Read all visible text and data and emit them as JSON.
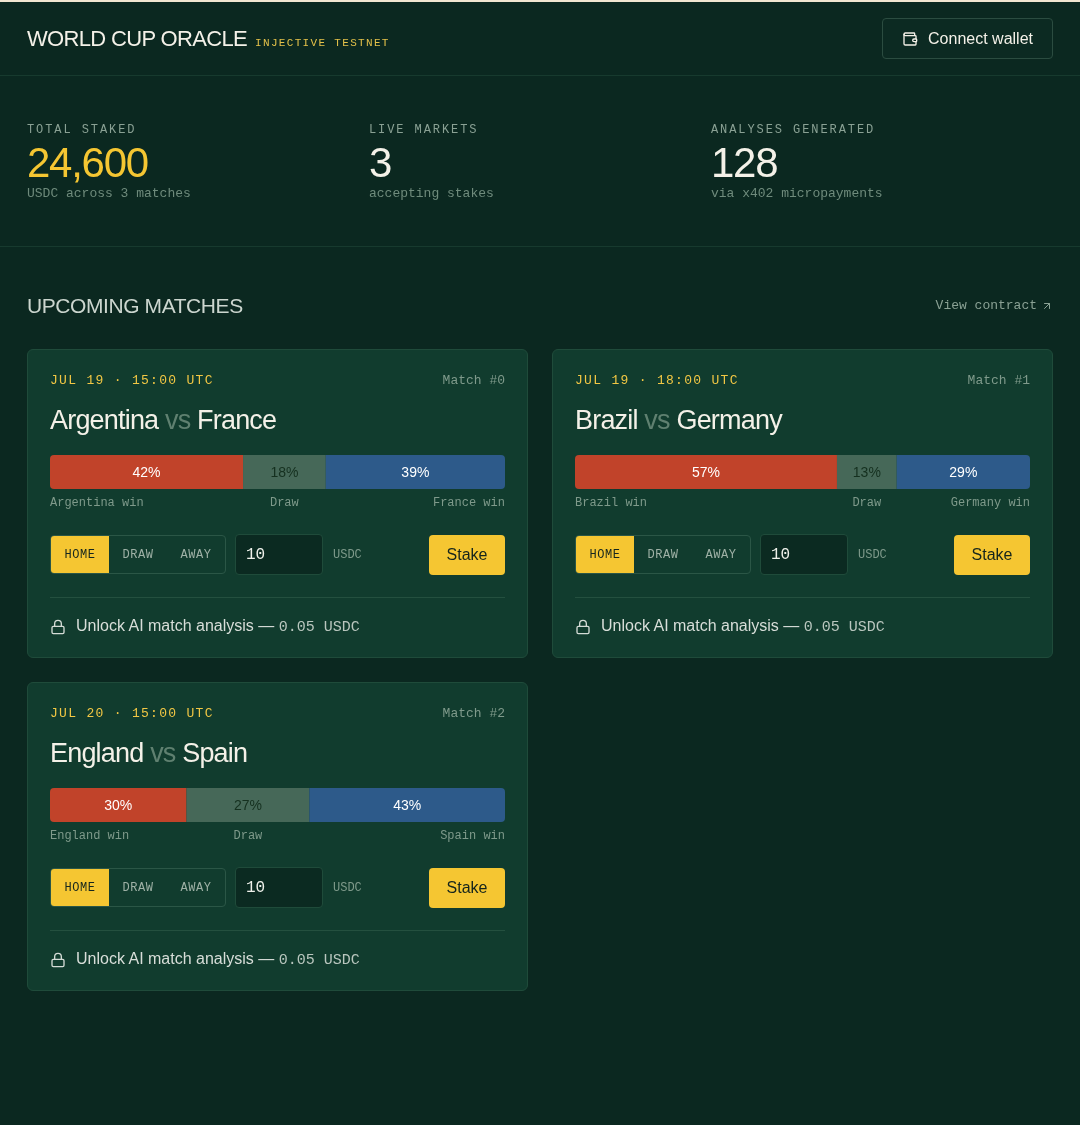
{
  "header": {
    "title": "WORLD CUP ORACLE",
    "network": "INJECTIVE TESTNET",
    "connect_button": "Connect wallet"
  },
  "stats": [
    {
      "label": "TOTAL STAKED",
      "value": "24,600",
      "note": "USDC across 3 matches",
      "highlight": true
    },
    {
      "label": "LIVE MARKETS",
      "value": "3",
      "note": "accepting stakes",
      "highlight": false
    },
    {
      "label": "ANALYSES GENERATED",
      "value": "128",
      "note": "via x402 micropayments",
      "highlight": false
    }
  ],
  "section": {
    "title": "UPCOMING MATCHES",
    "link": "View contract"
  },
  "matches": [
    {
      "date": "JUL 19 · 15:00 UTC",
      "number": "Match #0",
      "home": "Argentina",
      "vs": "vs",
      "away": "France",
      "odds": {
        "chart_data": {
          "type": "bar",
          "orientation": "horizontal",
          "stacked": true,
          "series": [
            {
              "name": "Argentina win",
              "color": "#c1432a",
              "values": [
                42
              ],
              "value_labels": [
                "42%"
              ]
            },
            {
              "name": "Draw",
              "color": "#466858",
              "values": [
                18
              ],
              "value_labels": [
                "18%"
              ]
            },
            {
              "name": "France win",
              "color": "#2d5a8a",
              "values": [
                39
              ],
              "value_labels": [
                "39%"
              ]
            }
          ]
        }
      },
      "options": [
        {
          "label": "HOME",
          "selected": true
        },
        {
          "label": "DRAW",
          "selected": false
        },
        {
          "label": "AWAY",
          "selected": false
        }
      ],
      "amount": "10",
      "currency": "USDC",
      "stake_button": "Stake",
      "unlock": {
        "label": "Unlock AI match analysis —",
        "price": "0.05 USDC"
      }
    },
    {
      "date": "JUL 19 · 18:00 UTC",
      "number": "Match #1",
      "home": "Brazil",
      "vs": "vs",
      "away": "Germany",
      "odds": {
        "chart_data": {
          "type": "bar",
          "orientation": "horizontal",
          "stacked": true,
          "series": [
            {
              "name": "Brazil win",
              "color": "#c1432a",
              "values": [
                57
              ],
              "value_labels": [
                "57%"
              ]
            },
            {
              "name": "Draw",
              "color": "#466858",
              "values": [
                13
              ],
              "value_labels": [
                "13%"
              ]
            },
            {
              "name": "Germany win",
              "color": "#2d5a8a",
              "values": [
                29
              ],
              "value_labels": [
                "29%"
              ]
            }
          ]
        }
      },
      "options": [
        {
          "label": "HOME",
          "selected": true
        },
        {
          "label": "DRAW",
          "selected": false
        },
        {
          "label": "AWAY",
          "selected": false
        }
      ],
      "amount": "10",
      "currency": "USDC",
      "stake_button": "Stake",
      "unlock": {
        "label": "Unlock AI match analysis —",
        "price": "0.05 USDC"
      }
    },
    {
      "date": "JUL 20 · 15:00 UTC",
      "number": "Match #2",
      "home": "England",
      "vs": "vs",
      "away": "Spain",
      "odds": {
        "chart_data": {
          "type": "bar",
          "orientation": "horizontal",
          "stacked": true,
          "series": [
            {
              "name": "England win",
              "color": "#c1432a",
              "values": [
                30
              ],
              "value_labels": [
                "30%"
              ]
            },
            {
              "name": "Draw",
              "color": "#466858",
              "values": [
                27
              ],
              "value_labels": [
                "27%"
              ]
            },
            {
              "name": "Spain win",
              "color": "#2d5a8a",
              "values": [
                43
              ],
              "value_labels": [
                "43%"
              ]
            }
          ]
        }
      },
      "options": [
        {
          "label": "HOME",
          "selected": true
        },
        {
          "label": "DRAW",
          "selected": false
        },
        {
          "label": "AWAY",
          "selected": false
        }
      ],
      "amount": "10",
      "currency": "USDC",
      "stake_button": "Stake",
      "unlock": {
        "label": "Unlock AI match analysis —",
        "price": "0.05 USDC"
      }
    }
  ]
}
